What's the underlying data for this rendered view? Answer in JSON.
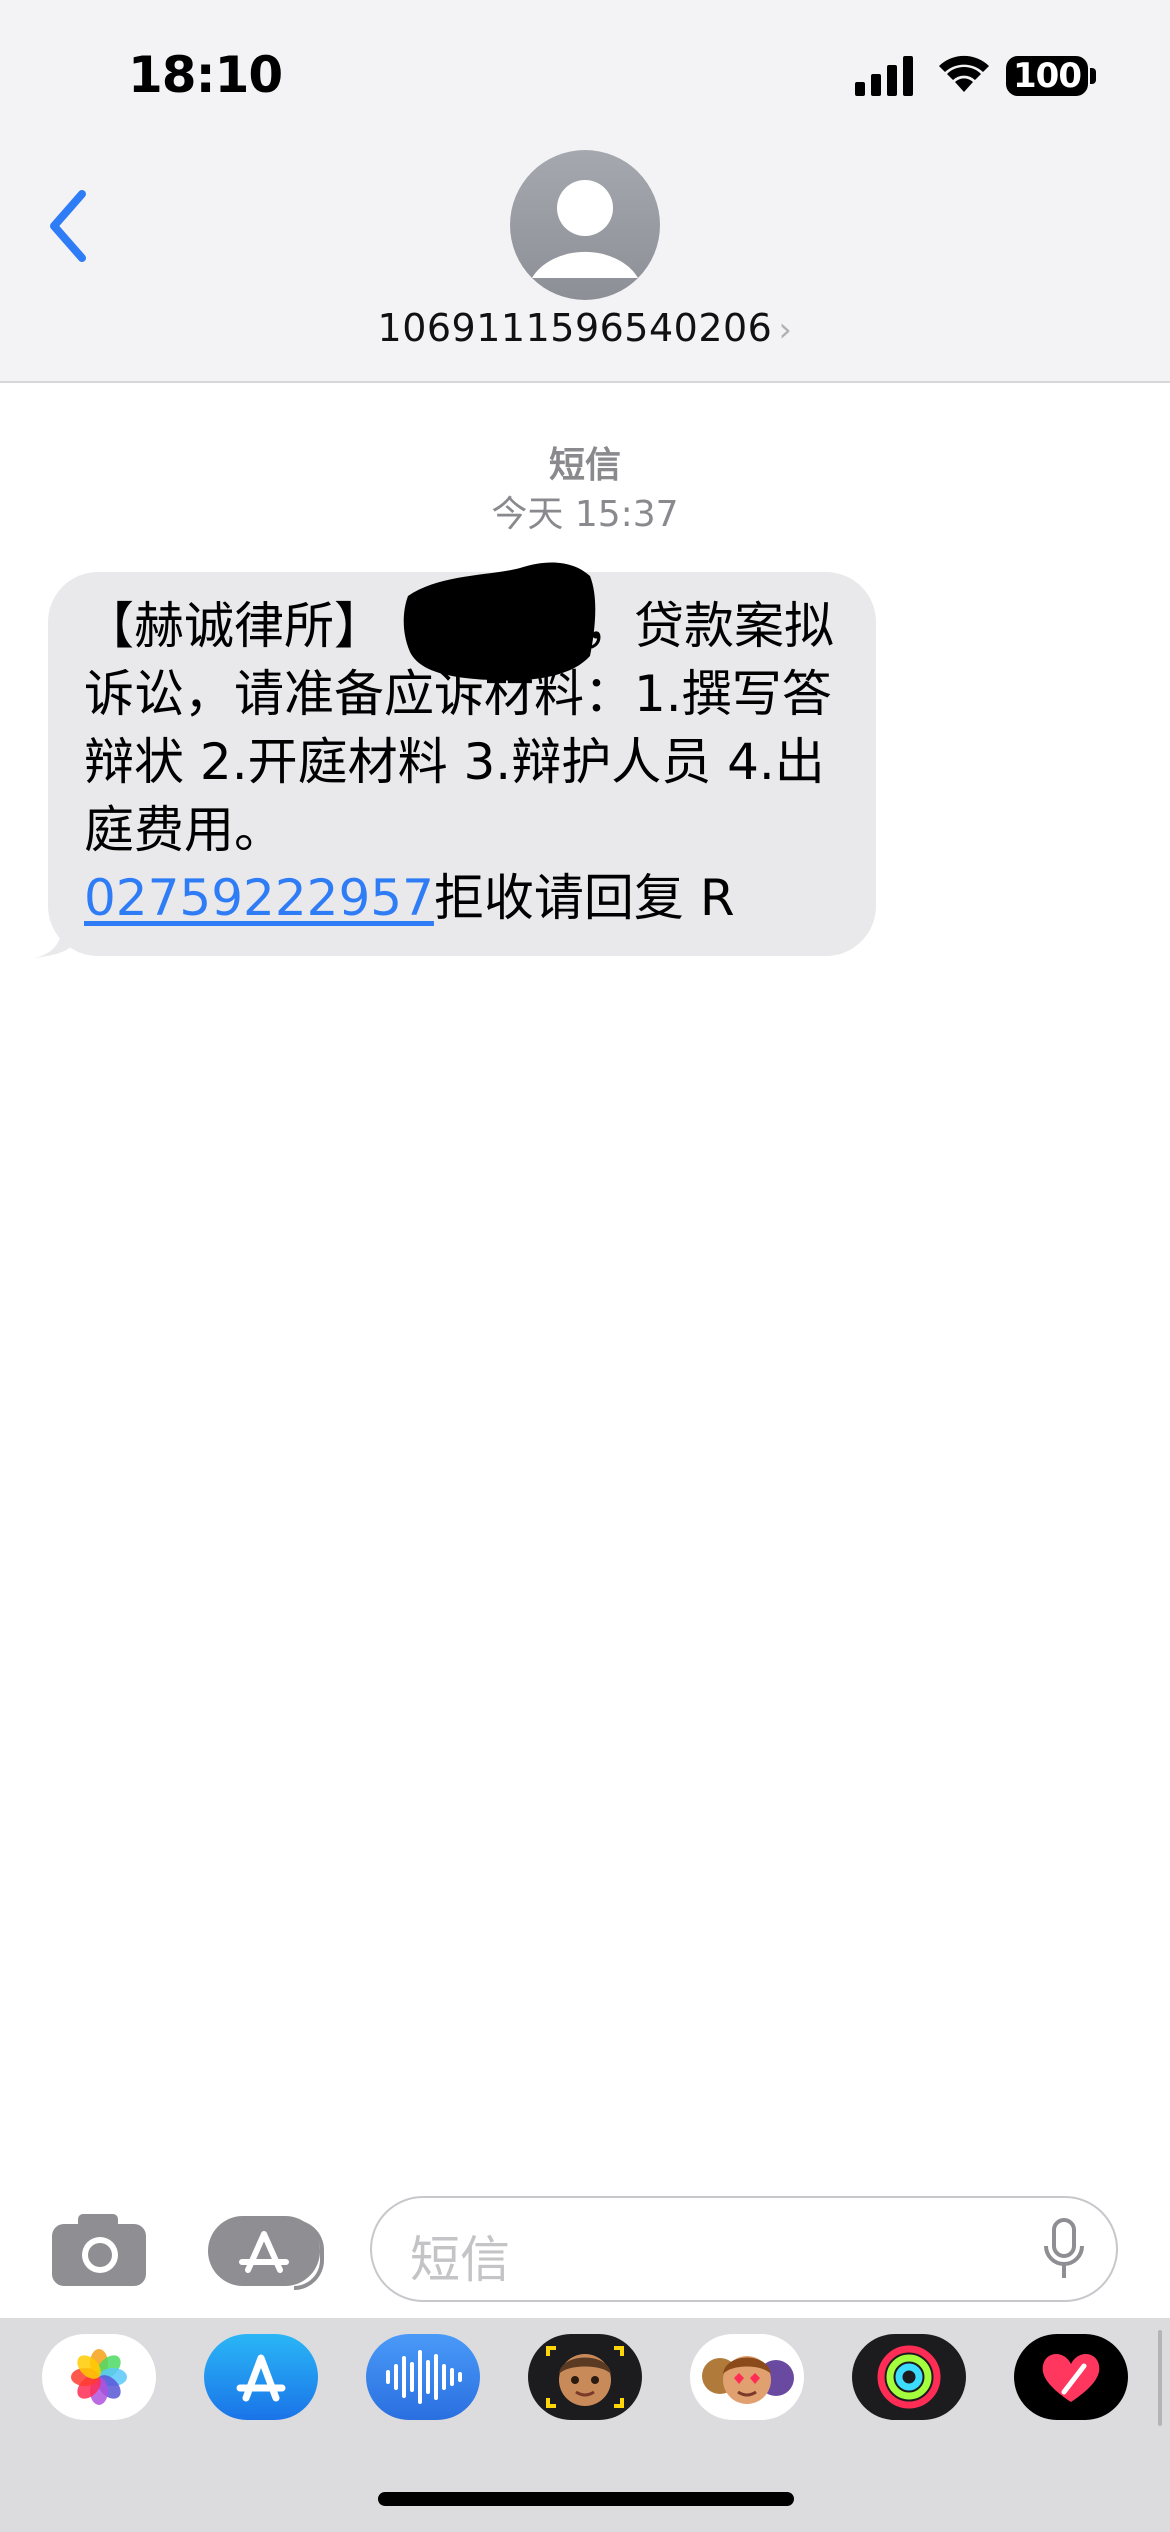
{
  "status_bar": {
    "time": "18:10",
    "battery": "100",
    "signal_icon": "cellular-signal-icon",
    "wifi_icon": "wifi-icon"
  },
  "header": {
    "back_icon": "chevron-left-icon",
    "avatar_icon": "person-avatar-icon",
    "contact": "1069111596540206",
    "chevron": "›"
  },
  "conversation": {
    "service_label": "短信",
    "timestamp": "今天 15:37"
  },
  "message": {
    "text_before_redaction": "【赫诚律所】",
    "text_after_redaction": "，贷款案拟诉讼，请准备应诉材料：1.撰写答辩状 2.开庭材料 3.辩护人员 4.出庭费用。",
    "phone_link": "02759222957",
    "opt_out": "拒收请回复 R"
  },
  "input_bar": {
    "camera_icon": "camera-icon",
    "apps_icon": "app-store-icon",
    "placeholder": "短信",
    "mic_icon": "microphone-icon"
  },
  "app_drawer": {
    "apps": [
      "photos-icon",
      "app-store-icon",
      "audio-message-icon",
      "memoji-icon",
      "animoji-stickers-icon",
      "fitness-icon",
      "digital-touch-icon"
    ]
  },
  "colors": {
    "accent": "#2e7cf6",
    "bubble_received": "#e9e9eb",
    "header_bg": "#f3f3f5"
  }
}
